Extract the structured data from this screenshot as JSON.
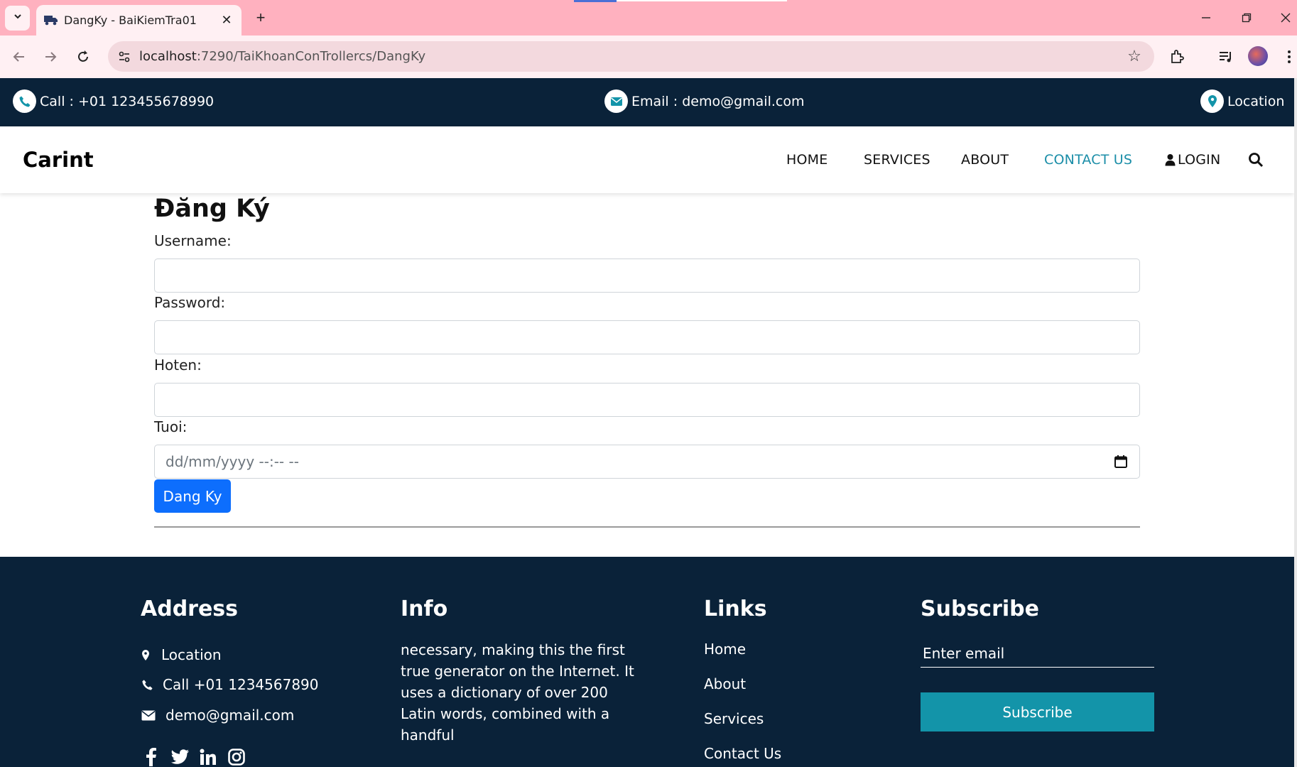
{
  "browser": {
    "tab_title": "DangKy - BaiKiemTra01",
    "url_host": "localhost",
    "url_rest": ":7290/TaiKhoanConTrollercs/DangKy"
  },
  "topbar": {
    "call": "Call : +01 123455678990",
    "email": "Email : demo@gmail.com",
    "location": "Location"
  },
  "nav": {
    "brand": "Carint",
    "items": [
      "HOME",
      "SERVICES",
      "ABOUT",
      "CONTACT US",
      "LOGIN"
    ],
    "active": "CONTACT US"
  },
  "form": {
    "title": "Đăng Ký",
    "username_label": "Username:",
    "password_label": "Password:",
    "hoten_label": "Hoten:",
    "tuoi_label": "Tuoi:",
    "tuoi_placeholder": "dd/mm/yyyy --:-- --",
    "submit_label": "Dang Ky"
  },
  "footer": {
    "address_heading": "Address",
    "address_location": "Location",
    "address_call": "Call +01 1234567890",
    "address_email": "demo@gmail.com",
    "info_heading": "Info",
    "info_text": "necessary, making this the first true generator on the Internet. It uses a dictionary of over 200 Latin words, combined with a handful",
    "links_heading": "Links",
    "links": [
      "Home",
      "About",
      "Services",
      "Contact Us"
    ],
    "subscribe_heading": "Subscribe",
    "subscribe_placeholder": "Enter email",
    "subscribe_button": "Subscribe"
  },
  "colors": {
    "dark_navy": "#0a2239",
    "accent_teal": "#1394a9",
    "primary_blue": "#0d6efd",
    "tab_pink": "#ffb1bf"
  },
  "icons": [
    "chevron-down-icon",
    "truck-icon",
    "close-icon",
    "plus-icon",
    "minimize-icon",
    "restore-icon",
    "window-close-icon",
    "back-arrow-icon",
    "forward-arrow-icon",
    "reload-icon",
    "site-info-icon",
    "star-icon",
    "extensions-icon",
    "media-icon",
    "profile-avatar",
    "menu-dots-icon",
    "phone-icon",
    "envelope-icon",
    "map-marker-icon",
    "user-icon",
    "search-icon",
    "calendar-icon",
    "facebook-icon",
    "twitter-icon",
    "linkedin-icon",
    "instagram-icon"
  ]
}
